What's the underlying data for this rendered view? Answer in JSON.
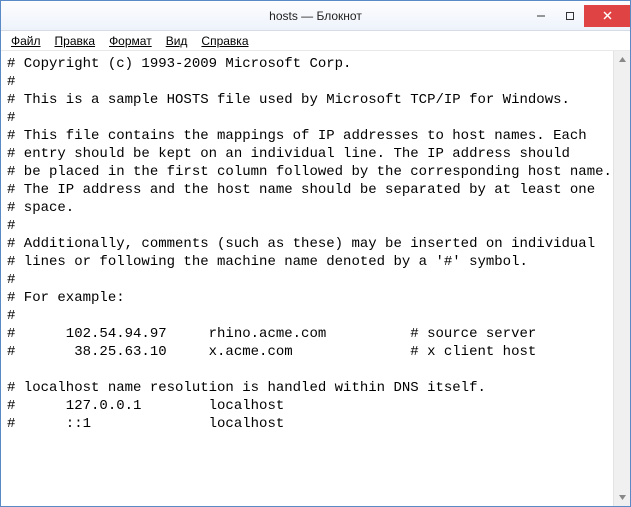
{
  "window": {
    "title": "hosts — Блокнот"
  },
  "menu": {
    "file": "Файл",
    "edit": "Правка",
    "format": "Формат",
    "view": "Вид",
    "help": "Справка"
  },
  "content": {
    "text": "# Copyright (c) 1993-2009 Microsoft Corp.\n#\n# This is a sample HOSTS file used by Microsoft TCP/IP for Windows.\n#\n# This file contains the mappings of IP addresses to host names. Each\n# entry should be kept on an individual line. The IP address should\n# be placed in the first column followed by the corresponding host name.\n# The IP address and the host name should be separated by at least one\n# space.\n#\n# Additionally, comments (such as these) may be inserted on individual\n# lines or following the machine name denoted by a '#' symbol.\n#\n# For example:\n#\n#      102.54.94.97     rhino.acme.com          # source server\n#       38.25.63.10     x.acme.com              # x client host\n\n# localhost name resolution is handled within DNS itself.\n#      127.0.0.1        localhost\n#      ::1              localhost"
  }
}
